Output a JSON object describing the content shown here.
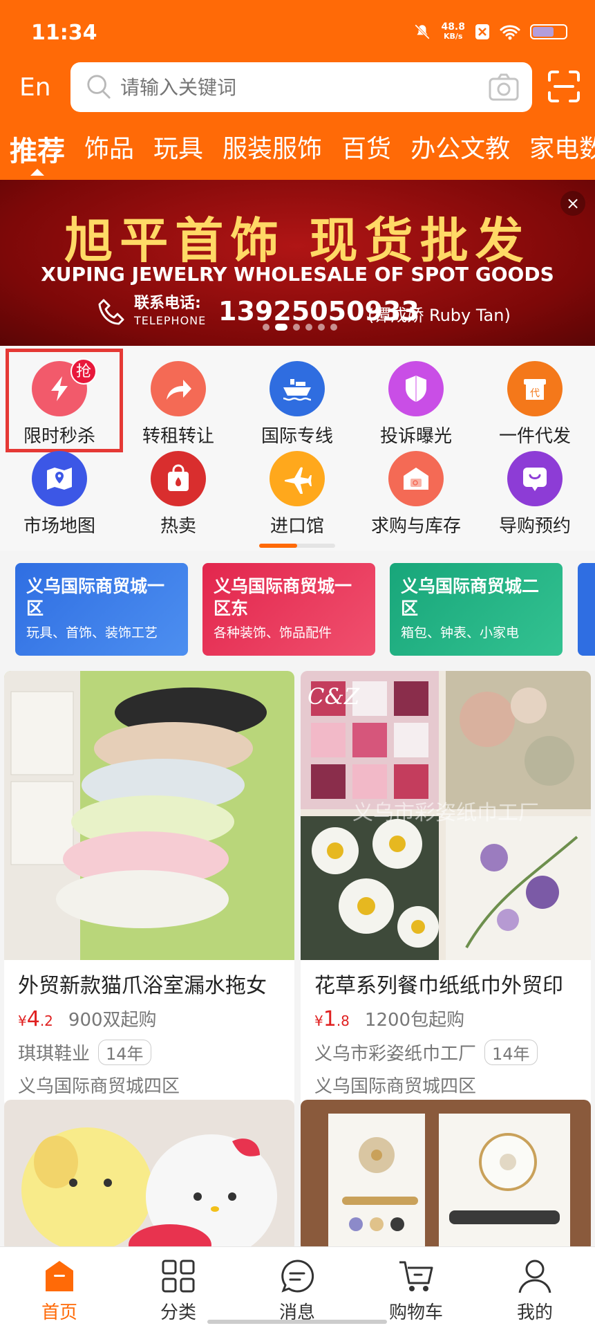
{
  "status": {
    "time": "11:34",
    "speed": "48.8",
    "speed_unit": "KB/s"
  },
  "header": {
    "lang": "En",
    "search_placeholder": "请输入关键词"
  },
  "tabs": [
    "推荐",
    "饰品",
    "玩具",
    "服装服饰",
    "百货",
    "办公文教",
    "家电数"
  ],
  "banner": {
    "title": "旭平首饰 现货批发",
    "subtitle": "XUPING JEWELRY WHOLESALE OF SPOT GOODS",
    "tel_label": "联系电话:",
    "tel_en": "TELEPHONE",
    "phone": "13925050933",
    "contact": "(谭成娇 Ruby Tan)",
    "close": "×"
  },
  "grid": [
    {
      "label": "限时秒杀",
      "badge": "抢",
      "color": "#f25a6b",
      "icon": "lightning-icon"
    },
    {
      "label": "转租转让",
      "color": "#f46a55",
      "icon": "share-arrow-icon"
    },
    {
      "label": "国际专线",
      "color": "#2f6de0",
      "icon": "ship-icon"
    },
    {
      "label": "投诉曝光",
      "color": "#c94ee6",
      "icon": "shield-icon"
    },
    {
      "label": "一件代发",
      "color": "#f4781a",
      "icon": "box-icon",
      "glyph": "代"
    },
    {
      "label": "市场地图",
      "color": "#3c57e6",
      "icon": "map-pin-icon"
    },
    {
      "label": "热卖",
      "color": "#d92e2e",
      "icon": "shopping-bag-icon"
    },
    {
      "label": "进口馆",
      "color": "#ffa81c",
      "icon": "airplane-icon"
    },
    {
      "label": "求购与库存",
      "color": "#f46a55",
      "icon": "warehouse-icon"
    },
    {
      "label": "导购预约",
      "color": "#8d3cd6",
      "icon": "chat-bubble-icon"
    }
  ],
  "markets": [
    {
      "title": "义乌国际商贸城一区",
      "sub": "玩具、首饰、装饰工艺",
      "color": "#2f6ee2"
    },
    {
      "title": "义乌国际商贸城一区东",
      "sub": "各种装饰、饰品配件",
      "color": "#e2264d"
    },
    {
      "title": "义乌国际商贸城二区",
      "sub": "箱包、钟表、小家电",
      "color": "#18a67a"
    }
  ],
  "products": [
    {
      "title": "外贸新款猫爪浴室漏水拖女",
      "currency": "¥",
      "price_int": "4",
      "price_dec": ".2",
      "moq": "900双起购",
      "shop": "琪琪鞋业",
      "years": "14年",
      "location": "义乌国际商贸城四区"
    },
    {
      "title": "花草系列餐巾纸纸巾外贸印",
      "currency": "¥",
      "price_int": "1",
      "price_dec": ".8",
      "moq": "1200包起购",
      "shop": "义乌市彩姿纸巾工厂",
      "years": "14年",
      "location": "义乌国际商贸城四区",
      "watermark": "义乌市彩姿纸巾工厂",
      "brand": "C&Z"
    }
  ],
  "bottom_nav": [
    "首页",
    "分类",
    "消息",
    "购物车",
    "我的"
  ]
}
